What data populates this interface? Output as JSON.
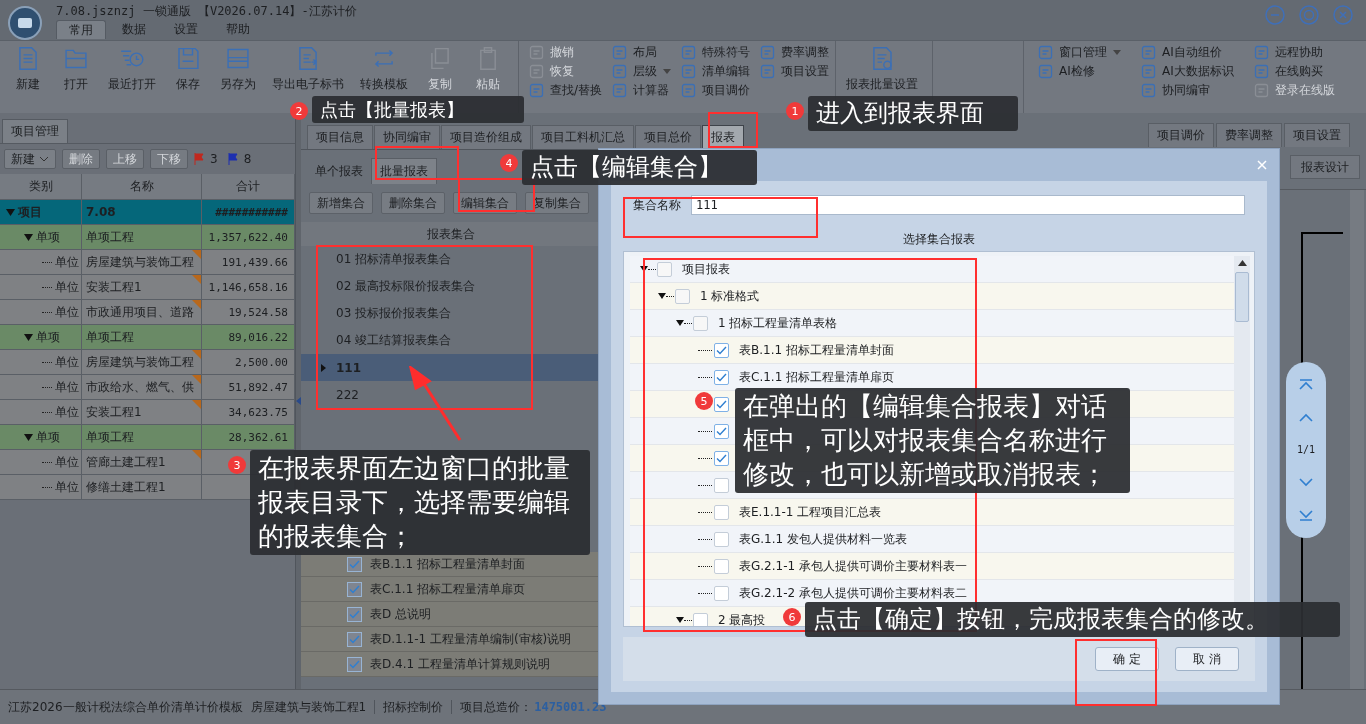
{
  "window": {
    "title": "7.08.jsznzj 一锁通版 【V2026.07.14】-江苏计价"
  },
  "menu_tabs": [
    {
      "label": "常用",
      "selected": true
    },
    {
      "label": "数据",
      "selected": false
    },
    {
      "label": "设置",
      "selected": false
    },
    {
      "label": "帮助",
      "selected": false
    }
  ],
  "ribbon": [
    {
      "kind": "large",
      "buttons": [
        {
          "label": "新建",
          "disabled": false
        },
        {
          "label": "打开",
          "disabled": false
        },
        {
          "label": "最近打开",
          "disabled": false
        },
        {
          "label": "保存",
          "disabled": false
        },
        {
          "label": "另存为",
          "disabled": false
        },
        {
          "label": "导出电子标书",
          "disabled": false
        },
        {
          "label": "转换模板",
          "disabled": false
        },
        {
          "label": "复制",
          "disabled": true
        },
        {
          "label": "粘贴",
          "disabled": true
        }
      ]
    },
    {
      "kind": "small",
      "columns": [
        [
          {
            "label": "撤销",
            "disabled": true
          },
          {
            "label": "恢复",
            "disabled": true
          },
          {
            "label": "查找/替换",
            "disabled": false
          }
        ],
        [
          {
            "label": "布局",
            "disabled": false
          },
          {
            "label": "层级",
            "disabled": false,
            "dropdown": true
          },
          {
            "label": "计算器",
            "disabled": false
          }
        ],
        [
          {
            "label": "特殊符号",
            "disabled": false
          },
          {
            "label": "清单编辑",
            "disabled": false
          },
          {
            "label": "项目调价",
            "disabled": false
          }
        ],
        [
          {
            "label": "费率调整",
            "disabled": false
          },
          {
            "label": "项目设置",
            "disabled": false
          }
        ]
      ]
    },
    {
      "kind": "large",
      "buttons": [
        {
          "label": "报表批量设置",
          "disabled": false
        }
      ]
    },
    {
      "kind": "small",
      "columns": [
        [
          {
            "label": "窗口管理",
            "disabled": false,
            "dropdown": true
          },
          {
            "label": "AI检修",
            "disabled": false
          }
        ],
        [
          {
            "label": "AI自动组价",
            "disabled": false
          },
          {
            "label": "AI大数据标识",
            "disabled": false
          },
          {
            "label": "协同编审",
            "disabled": false
          }
        ],
        [
          {
            "label": "远程协助",
            "disabled": false
          },
          {
            "label": "在线购买",
            "disabled": false
          },
          {
            "label": "登录在线版",
            "disabled": true
          }
        ]
      ]
    }
  ],
  "project_panel": {
    "tab": "项目管理",
    "toolbar": [
      {
        "kind": "dropdown",
        "label": "新建",
        "disabled": false
      },
      {
        "kind": "button",
        "label": "删除",
        "disabled": true
      },
      {
        "kind": "button",
        "label": "上移",
        "disabled": true
      },
      {
        "kind": "button",
        "label": "下移",
        "disabled": true
      },
      {
        "kind": "flag",
        "color": "#c0281e",
        "count": "3"
      },
      {
        "kind": "flag",
        "color": "#1c2fb0",
        "count": "8"
      }
    ],
    "columns": [
      "类别",
      "名称",
      "合计"
    ],
    "rows": [
      {
        "category": "项目",
        "name": "7.08",
        "total": "###########",
        "expanded": true,
        "children": [
          {
            "category": "单项",
            "name": "单项工程",
            "total": "1,357,622.40",
            "expanded": true,
            "children": [
              {
                "category": "单位",
                "name": "房屋建筑与装饰工程",
                "total": "191,439.66",
                "marked": true
              },
              {
                "category": "单位",
                "name": "安装工程1",
                "total": "1,146,658.16",
                "marked": true
              },
              {
                "category": "单位",
                "name": "市政通用项目、道路",
                "total": "19,524.58",
                "marked": true
              }
            ]
          },
          {
            "category": "单项",
            "name": "单项工程",
            "total": "89,016.22",
            "expanded": true,
            "children": [
              {
                "category": "单位",
                "name": "房屋建筑与装饰工程",
                "total": "2,500.00",
                "marked": true
              },
              {
                "category": "单位",
                "name": "市政给水、燃气、供",
                "total": "51,892.47",
                "marked": true
              },
              {
                "category": "单位",
                "name": "安装工程1",
                "total": "34,623.75",
                "marked": true
              }
            ]
          },
          {
            "category": "单项",
            "name": "单项工程",
            "total": "28,362.61",
            "expanded": true,
            "children": [
              {
                "category": "单位",
                "name": "管廊土建工程1",
                "marked": true
              },
              {
                "category": "单位",
                "name": "修缮土建工程1",
                "marked": false
              }
            ]
          }
        ]
      }
    ]
  },
  "content_tabs": [
    {
      "label": "项目信息",
      "selected": false
    },
    {
      "label": "协同编审",
      "selected": false
    },
    {
      "label": "项目造价组成",
      "selected": false
    },
    {
      "label": "项目工料机汇总",
      "selected": false
    },
    {
      "label": "项目总价",
      "selected": false
    },
    {
      "label": "报表",
      "selected": true
    }
  ],
  "report_tabs": [
    {
      "label": "单个报表",
      "selected": false
    },
    {
      "label": "批量报表",
      "selected": true
    }
  ],
  "set_buttons": [
    "新增集合",
    "删除集合",
    "编辑集合",
    "复制集合"
  ],
  "report_sets": {
    "header": "报表集合",
    "rows": [
      {
        "label": "01 招标清单报表集合",
        "selected": false
      },
      {
        "label": "02 最高投标限价报表集合",
        "selected": false
      },
      {
        "label": "03 投标报价报表集合",
        "selected": false
      },
      {
        "label": "04 竣工结算报表集合",
        "selected": false
      },
      {
        "label": "111",
        "selected": true
      },
      {
        "label": "222",
        "selected": false
      }
    ]
  },
  "set_reports": [
    {
      "label": "表B.1.1 招标工程量清单封面",
      "checked": true
    },
    {
      "label": "表C.1.1 招标工程量清单扉页",
      "checked": true
    },
    {
      "label": "表D 总说明",
      "checked": true
    },
    {
      "label": "表D.1.1-1 工程量清单编制(审核)说明",
      "checked": true
    },
    {
      "label": "表D.4.1 工程量清单计算规则说明",
      "checked": true
    }
  ],
  "side_tabs": [
    {
      "label": "项目调价",
      "selected": false
    },
    {
      "label": "费率调整",
      "selected": false
    },
    {
      "label": "项目设置",
      "selected": false
    }
  ],
  "design_button": "报表设计",
  "pager": {
    "page": "1/1"
  },
  "dialog": {
    "name_label": "集合名称",
    "name_value": "111",
    "list_title": "选择集合报表",
    "tree": [
      {
        "label": "项目报表",
        "checked": false,
        "expanded": true,
        "children": [
          {
            "label": "1 标准格式",
            "checked": false,
            "expanded": true,
            "children": [
              {
                "label": "1 招标工程量清单表格",
                "checked": false,
                "expanded": true,
                "children": [
                  {
                    "label": "表B.1.1 招标工程量清单封面",
                    "checked": true
                  },
                  {
                    "label": "表C.1.1 招标工程量清单扉页",
                    "checked": true
                  },
                  {
                    "checked": true
                  },
                  {
                    "checked": true
                  },
                  {
                    "checked": true
                  },
                  {
                    "checked": false
                  },
                  {
                    "label": "表E.1.1-1 工程项目汇总表",
                    "checked": false
                  },
                  {
                    "label": "表G.1.1 发包人提供材料一览表",
                    "checked": false
                  },
                  {
                    "label": "表G.2.1-1 承包人提供可调价主要材料表一",
                    "checked": false
                  },
                  {
                    "label": "表G.2.1-2 承包人提供可调价主要材料表二",
                    "checked": false
                  }
                ]
              },
              {
                "label": "2 最高投",
                "checked": false,
                "expanded": true
              }
            ]
          }
        ]
      }
    ],
    "buttons": [
      "确 定",
      "取 消"
    ]
  },
  "status_bar": {
    "template": "江苏2026一般计税法综合单价清单计价模板",
    "unit": "房屋建筑与装饰工程1",
    "mode": "招标控制价",
    "total_label": "项目总造价：",
    "total_value": "1475001.23"
  },
  "annotations": [
    {
      "number": "2",
      "text": "点击【批量报表】"
    },
    {
      "number": "1",
      "text": "进入到报表界面"
    },
    {
      "number": "4",
      "text": "点击【编辑集合】"
    },
    {
      "number": "3",
      "text": "在报表界面左边窗口的批量报表目录下，选择需要编辑的报表集合；"
    },
    {
      "number": "5",
      "text": "在弹出的【编辑集合报表】对话框中，可以对报表集合名称进行修改，也可以新增或取消报表；"
    },
    {
      "number": "6",
      "text": "点击【确定】按钮，完成报表集合的修改。"
    }
  ]
}
